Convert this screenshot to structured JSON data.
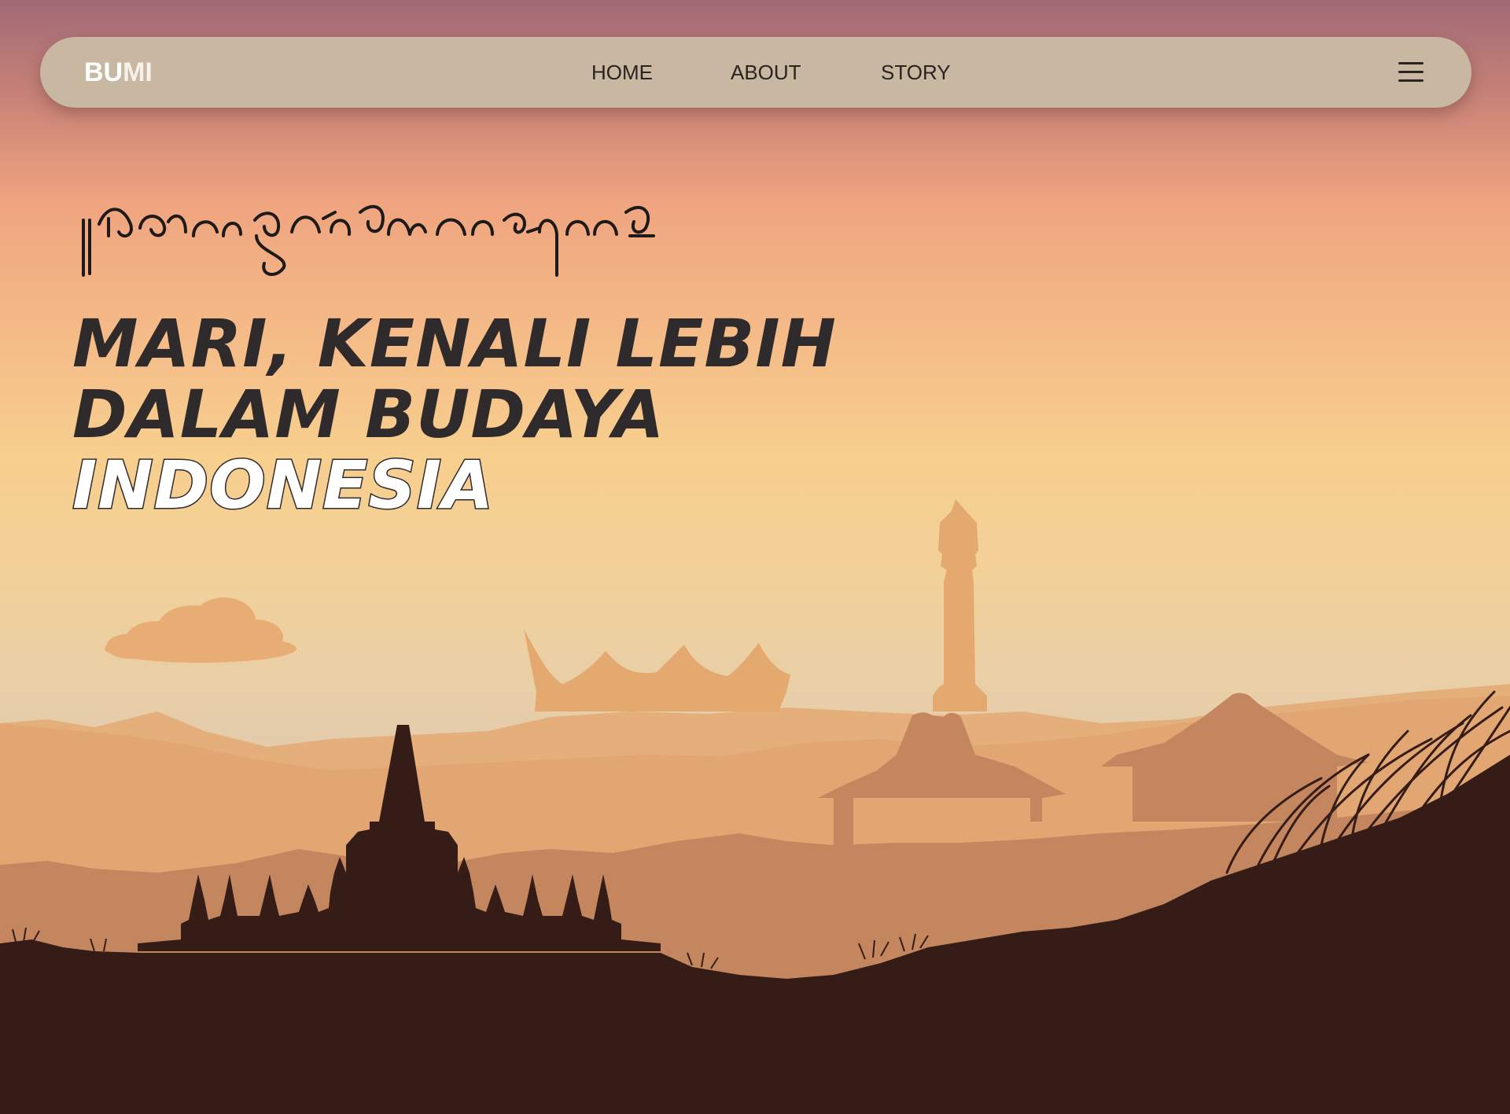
{
  "navbar": {
    "brand": {
      "part1": "BU",
      "part2": "MI"
    },
    "links": [
      {
        "label": "HOME"
      },
      {
        "label": "ABOUT"
      },
      {
        "label": "STORY"
      }
    ],
    "menu_icon": "hamburger-menu-icon"
  },
  "hero": {
    "script_line": "ꦩꦫꦶꦏꦼꦤꦭꦶꦭꦼꦧꦶꦃꦢꦭꦩ꧀ꦧꦸꦢꦪꦆꦤ꧀ꦢꦺꦴꦤꦺꦱꦶꦪ",
    "headline_line1": "MARI, KENALI LEBIH",
    "headline_line2": "DALAM BUDAYA",
    "headline_line3": "INDONESIA"
  },
  "colors": {
    "navbar_bg": "#c8b7a1",
    "text_dark": "#2f2a2b",
    "silhouette_dark": "#351c16",
    "silhouette_mid": "#c3865e",
    "silhouette_light": "#e4a96f"
  }
}
